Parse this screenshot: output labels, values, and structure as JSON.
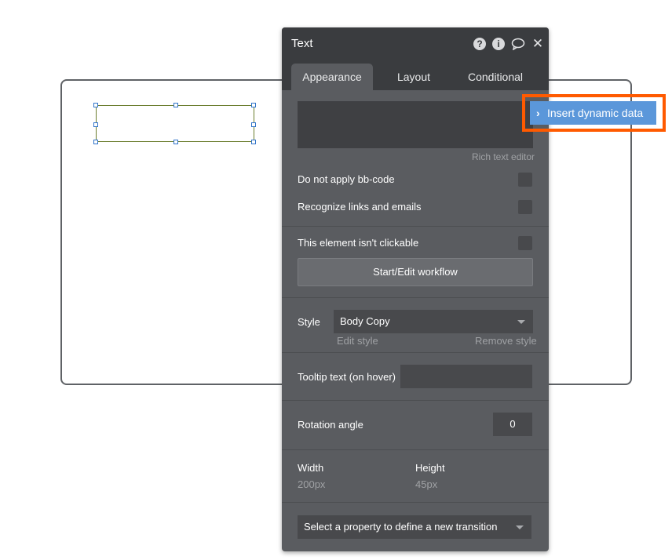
{
  "panel": {
    "title": "Text",
    "header_icons": [
      "help-icon",
      "info-icon",
      "comment-icon",
      "close-icon"
    ],
    "tabs": [
      {
        "label": "Appearance",
        "active": true
      },
      {
        "label": "Layout",
        "active": false
      },
      {
        "label": "Conditional",
        "active": false
      }
    ],
    "rich_text_editor_label": "Rich text editor",
    "options": {
      "bbcode_label": "Do not apply bb-code",
      "links_label": "Recognize links and emails",
      "clickable_label": "This element isn't clickable"
    },
    "workflow_button": "Start/Edit workflow",
    "style": {
      "label": "Style",
      "value": "Body Copy",
      "edit_label": "Edit style",
      "remove_label": "Remove style"
    },
    "tooltip": {
      "label": "Tooltip text (on hover)",
      "value": ""
    },
    "rotation": {
      "label": "Rotation angle",
      "value": "0"
    },
    "dimensions": {
      "width_label": "Width",
      "width_value": "200px",
      "height_label": "Height",
      "height_value": "45px"
    },
    "transition_select": "Select a property to define a new transition"
  },
  "dynamic_data": {
    "label": "Insert dynamic data"
  },
  "colors": {
    "panel_bg": "#5a5c60",
    "header_bg": "#3a3c3f",
    "accent_blue": "#5b97da",
    "highlight": "#ff5a00"
  }
}
